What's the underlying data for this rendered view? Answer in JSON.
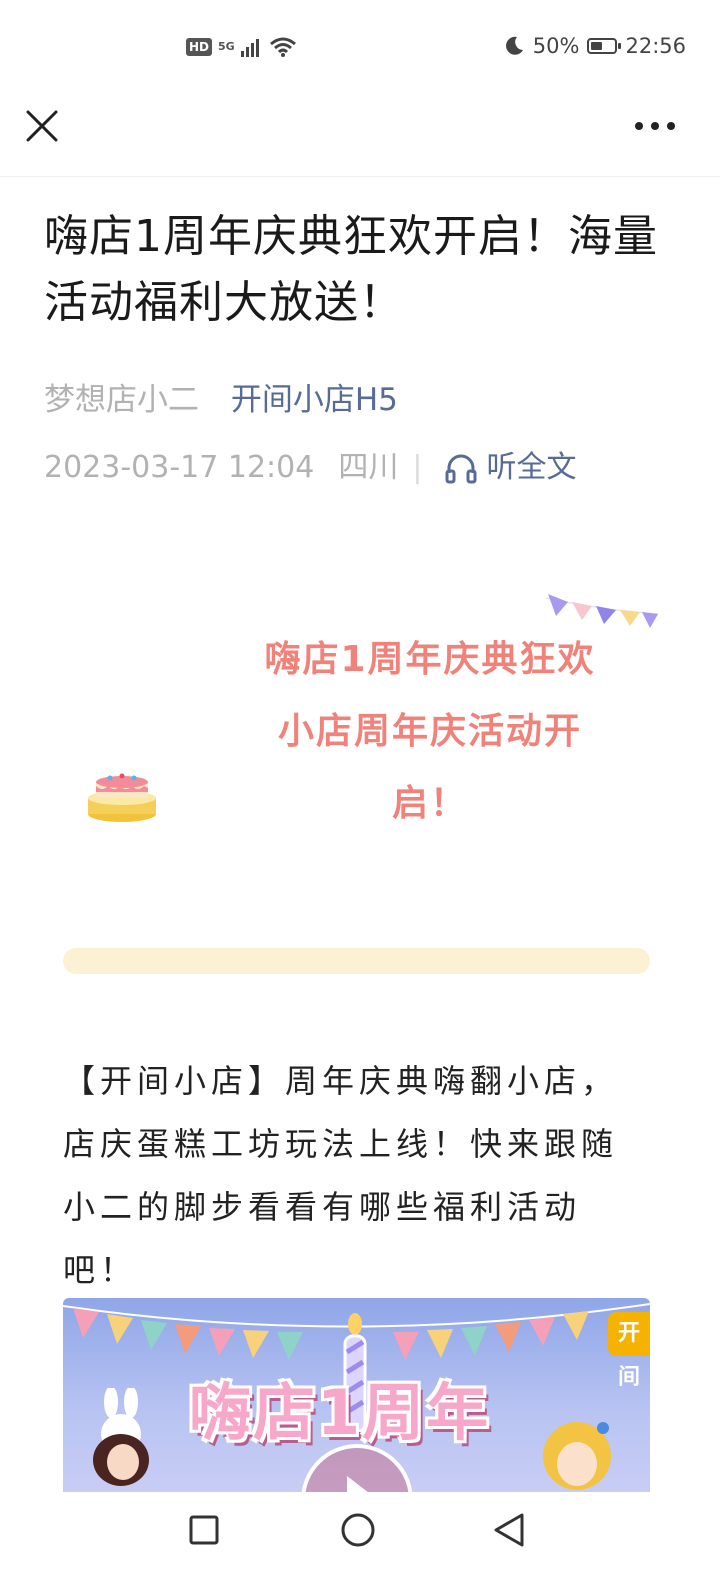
{
  "status_bar": {
    "hd_badge": "HD",
    "network": "5G",
    "battery_text": "50%",
    "battery_level": 0.5,
    "time": "22:56",
    "icons": [
      "signal-icon",
      "wifi-icon",
      "moon-icon",
      "battery-icon"
    ]
  },
  "nav": {
    "close_icon": "close-icon",
    "more_icon": "more-icon"
  },
  "article": {
    "title": "嗨店1周年庆典狂欢开启！海量活动福利大放送！",
    "author": "梦想店小二",
    "account": "开间小店H5",
    "datetime": "2023-03-17 12:04",
    "location": "四川",
    "listen_label": "听全文",
    "banner_line1": "嗨店1周年庆典狂欢",
    "banner_line2": "小店周年庆活动开启！",
    "body": "【开间小店】周年庆典嗨翻小店，店庆蛋糕工坊玩法上线！快来跟随小二的脚步看看有哪些福利活动吧！",
    "image_title": "嗨店1周年",
    "image_logo": "开间"
  },
  "colors": {
    "link": "#576b95",
    "meta": "#b2b2b2",
    "banner_text": "#f0827a",
    "bar": "#fdf1d3"
  }
}
